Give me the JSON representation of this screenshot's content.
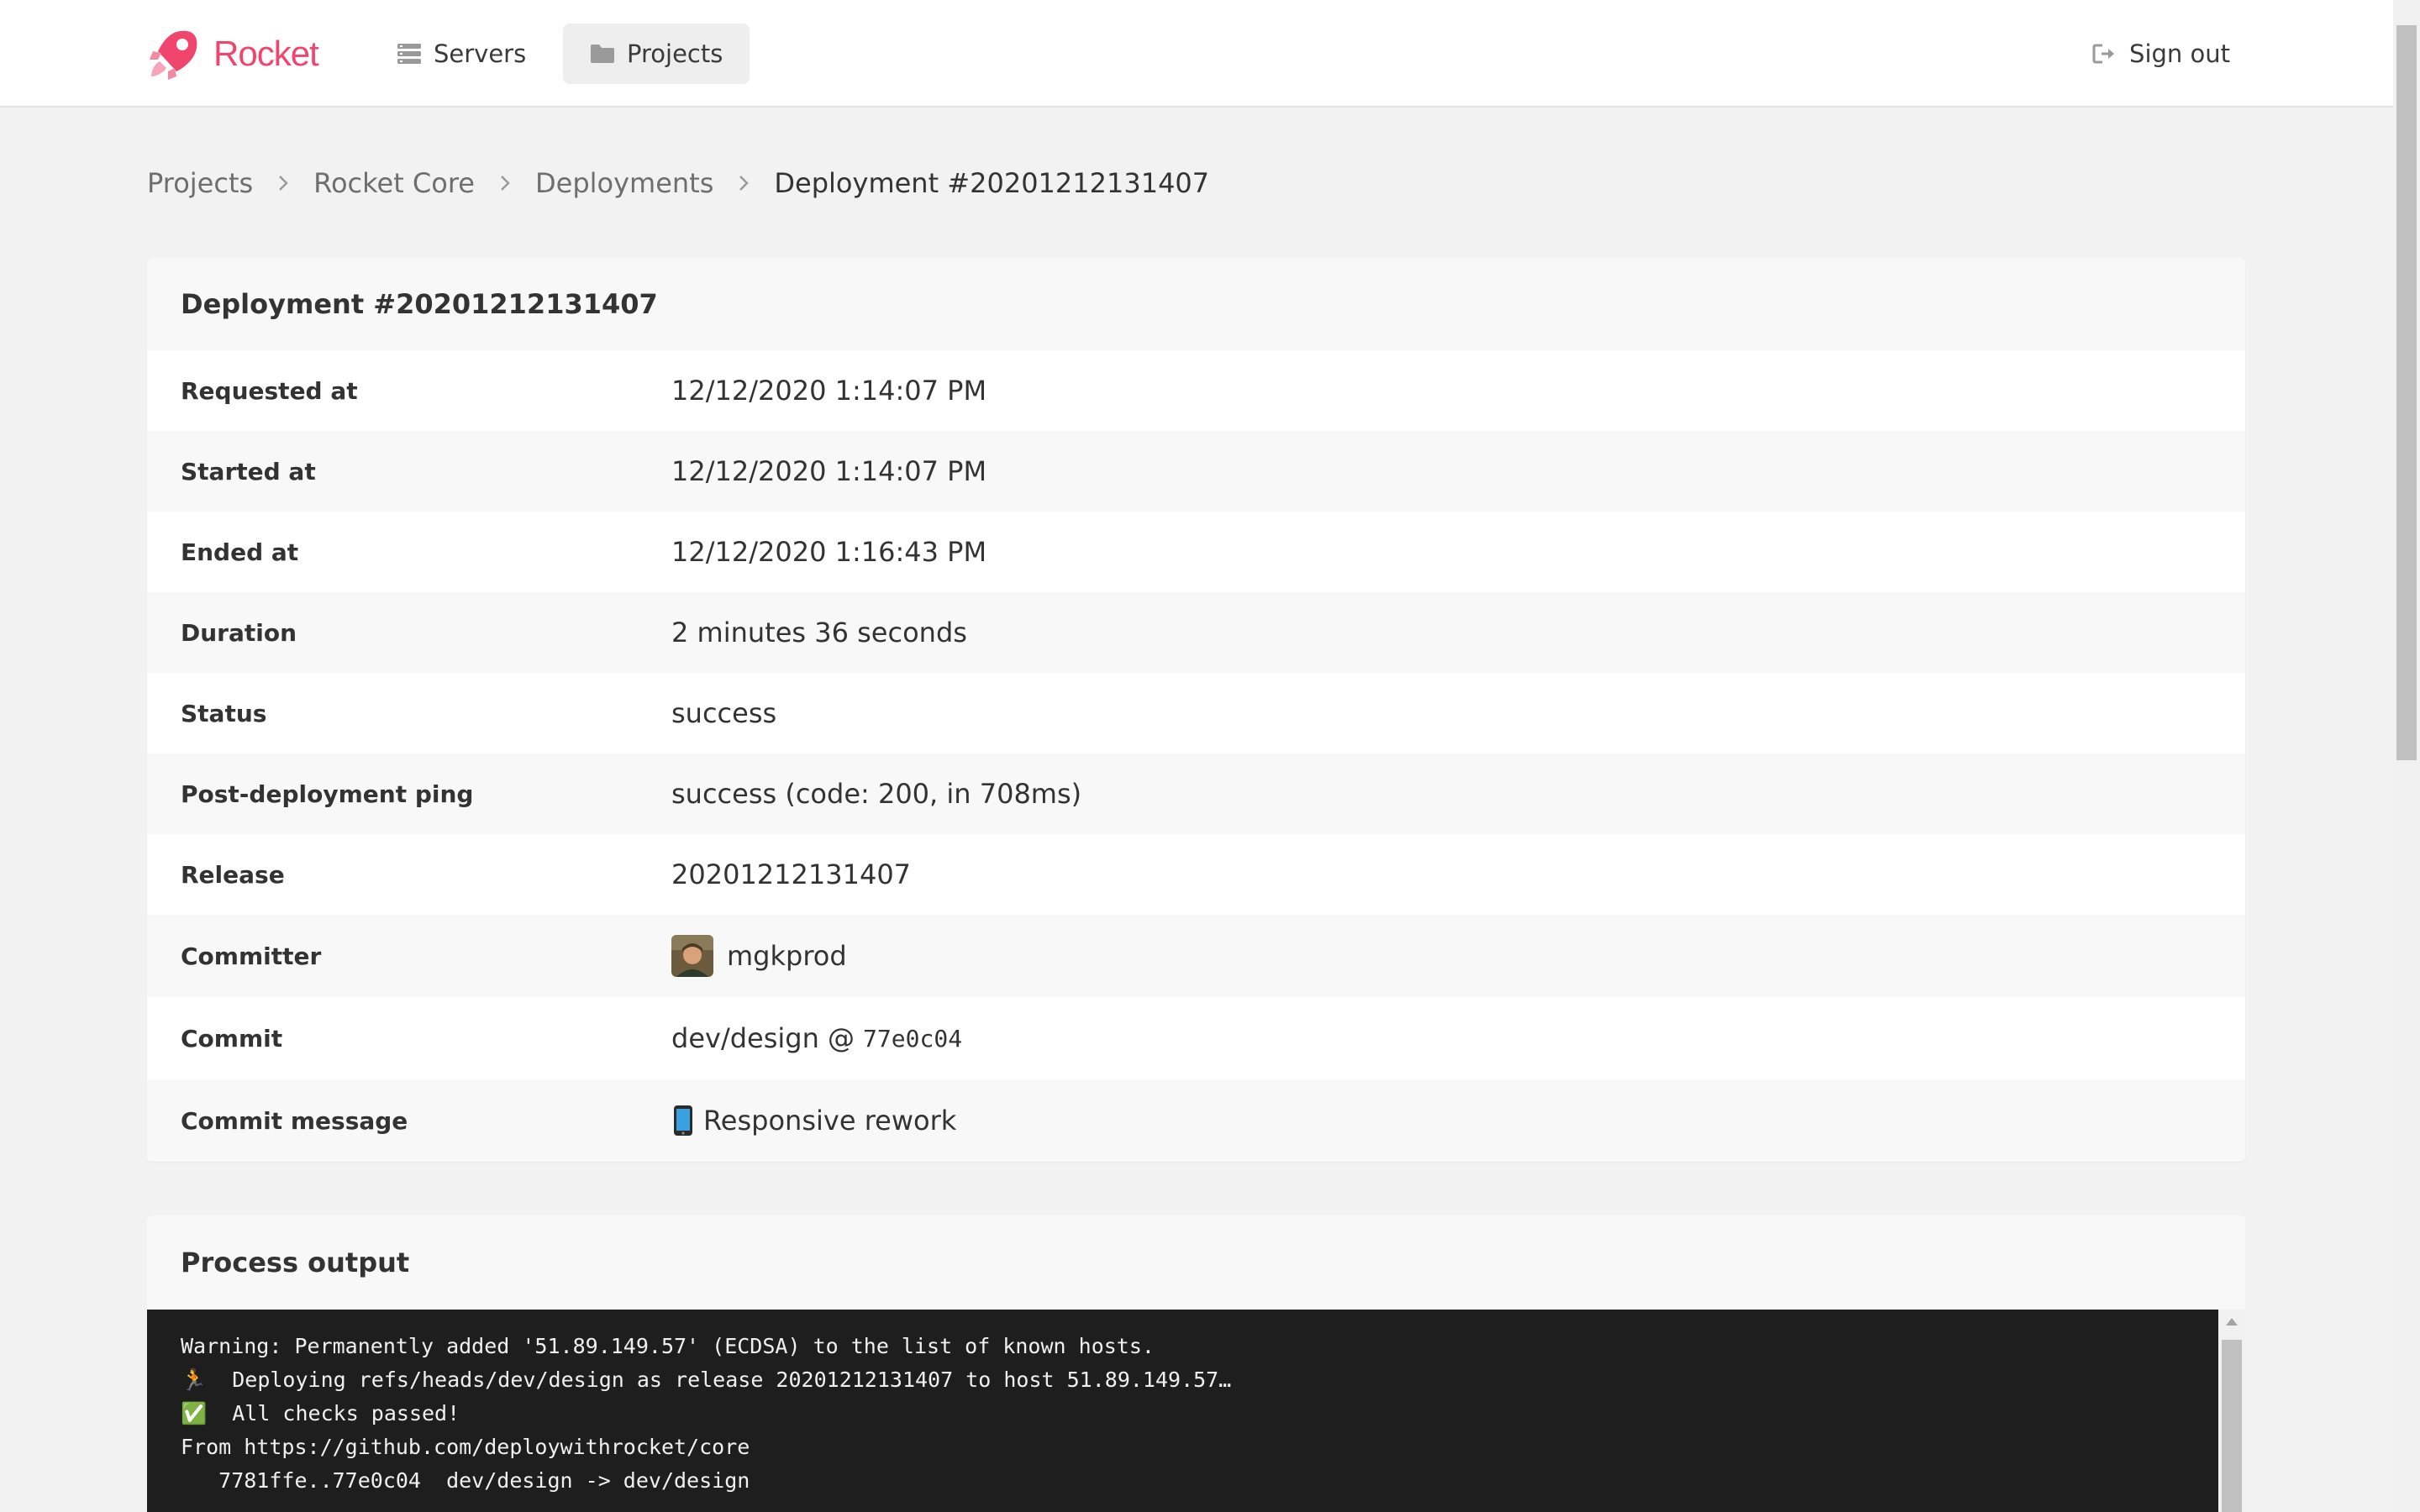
{
  "app": {
    "name": "Rocket",
    "brand_color": "#f0466e"
  },
  "nav": {
    "servers": {
      "label": "Servers",
      "icon": "server-icon"
    },
    "projects": {
      "label": "Projects",
      "icon": "folder-icon",
      "active": true
    },
    "sign_out": {
      "label": "Sign out",
      "icon": "sign-out-icon"
    }
  },
  "breadcrumb": [
    "Projects",
    "Rocket Core",
    "Deployments",
    "Deployment #20201212131407"
  ],
  "deployment": {
    "title": "Deployment #20201212131407",
    "rows": [
      {
        "label": "Requested at",
        "value": "12/12/2020 1:14:07 PM"
      },
      {
        "label": "Started at",
        "value": "12/12/2020 1:14:07 PM"
      },
      {
        "label": "Ended at",
        "value": "12/12/2020 1:16:43 PM"
      },
      {
        "label": "Duration",
        "value": "2 minutes 36 seconds"
      },
      {
        "label": "Status",
        "value": "success"
      },
      {
        "label": "Post-deployment ping",
        "value": "success (code: 200, in 708ms)"
      },
      {
        "label": "Release",
        "value": "20201212131407"
      },
      {
        "label": "Committer",
        "value": "mgkprod"
      },
      {
        "label": "Commit",
        "branch": "dev/design @",
        "hash": "77e0c04"
      },
      {
        "label": "Commit message",
        "value": "Responsive rework",
        "icon": "mobile-phone-icon"
      }
    ]
  },
  "process_output": {
    "title": "Process output",
    "lines": [
      "Warning: Permanently added '51.89.149.57' (ECDSA) to the list of known hosts.",
      "🏃  Deploying refs/heads/dev/design as release 20201212131407 to host 51.89.149.57…",
      "✅  All checks passed!",
      "From https://github.com/deploywithrocket/core",
      "   7781ffe..77e0c04  dev/design -> dev/design"
    ]
  }
}
